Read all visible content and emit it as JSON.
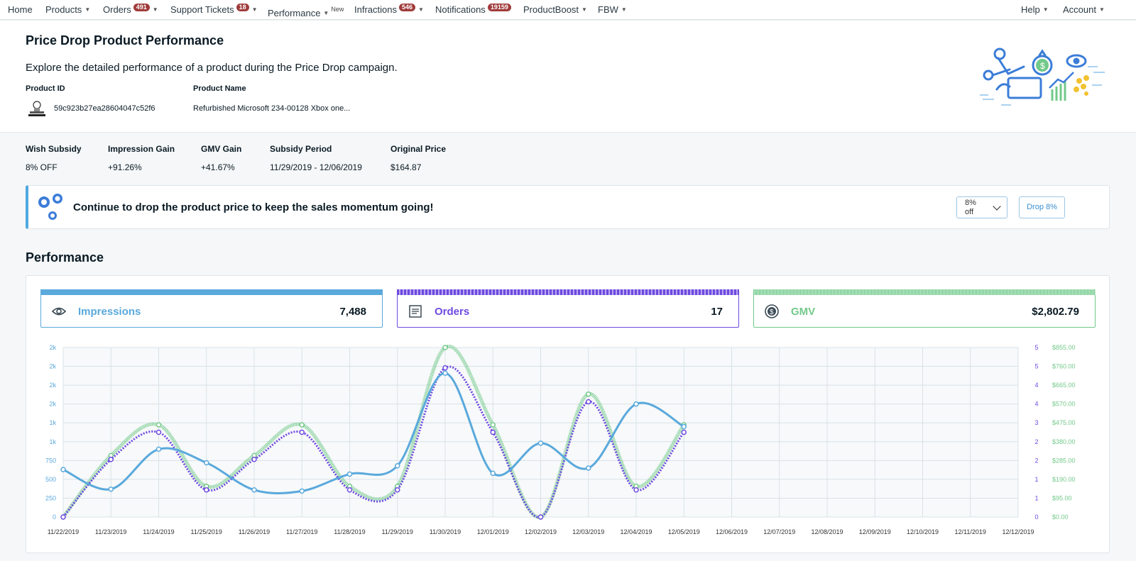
{
  "nav": {
    "home": "Home",
    "products": "Products",
    "orders": "Orders",
    "orders_badge": "491",
    "support": "Support Tickets",
    "support_badge": "18",
    "performance": "Performance",
    "performance_tag": "New",
    "infractions": "Infractions",
    "infractions_badge": "546",
    "notifications": "Notifications",
    "notifications_badge": "19159",
    "productboost": "ProductBoost",
    "fbw": "FBW",
    "help": "Help",
    "account": "Account"
  },
  "header": {
    "title": "Price Drop Product Performance",
    "description": "Explore the detailed performance of a product during the Price Drop campaign.",
    "product_id_label": "Product ID",
    "product_id": "59c923b27ea28604047c52f6",
    "product_name_label": "Product Name",
    "product_name": "Refurbished Microsoft 234-00128 Xbox one..."
  },
  "stats": [
    {
      "label": "Wish Subsidy",
      "value": "8% OFF"
    },
    {
      "label": "Impression Gain",
      "value": "+91.26%"
    },
    {
      "label": "GMV Gain",
      "value": "+41.67%"
    },
    {
      "label": "Subsidy Period",
      "value": "11/29/2019 - 12/06/2019"
    },
    {
      "label": "Original Price",
      "value": "$164.87"
    }
  ],
  "banner": {
    "message": "Continue to drop the product price to keep the sales momentum going!",
    "select_value": "8% off",
    "button_label": "Drop 8%"
  },
  "performance": {
    "title": "Performance",
    "cards": [
      {
        "label": "Impressions",
        "value": "7,488",
        "color": "#5aa9dc",
        "icon": "eye-icon"
      },
      {
        "label": "Orders",
        "value": "17",
        "color": "#6e4ae0",
        "icon": "receipt-icon"
      },
      {
        "label": "GMV",
        "value": "$2,802.79",
        "color": "#72c98a",
        "icon": "dollar-coin-icon"
      }
    ]
  },
  "chart_data": {
    "type": "line",
    "x": [
      "11/22/2019",
      "11/23/2019",
      "11/24/2019",
      "11/25/2019",
      "11/26/2019",
      "11/27/2019",
      "11/28/2019",
      "11/29/2019",
      "11/30/2019",
      "12/01/2019",
      "12/02/2019",
      "12/03/2019",
      "12/04/2019",
      "12/05/2019",
      "12/06/2019",
      "12/07/2019",
      "12/08/2019",
      "12/09/2019",
      "12/10/2019",
      "12/11/2019",
      "12/12/2019"
    ],
    "y_left_ticks": [
      "0",
      "250",
      "500",
      "750",
      "1k",
      "1k",
      "2k",
      "2k",
      "2k",
      "2k"
    ],
    "y_right1_ticks": [
      "0",
      "1",
      "1",
      "2",
      "2",
      "3",
      "4",
      "4",
      "5",
      "5"
    ],
    "y_right2_ticks": [
      "$0.00",
      "$95.00",
      "$190.00",
      "$285.00",
      "$380.00",
      "$475.00",
      "$570.00",
      "$665.00",
      "$760.00",
      "$855.00"
    ],
    "series": [
      {
        "name": "Impressions",
        "axis": "left",
        "color": "#5aa9dc",
        "values": [
          630,
          370,
          900,
          720,
          360,
          345,
          570,
          680,
          1910,
          580,
          980,
          650,
          1500,
          1200
        ]
      },
      {
        "name": "Orders",
        "axis": "right1",
        "color": "#6e4ae0",
        "values": [
          0,
          1.7,
          2.5,
          0.8,
          1.7,
          2.5,
          0.8,
          0.8,
          4.4,
          2.5,
          0,
          3.4,
          0.8,
          2.5
        ]
      },
      {
        "name": "GMV",
        "axis": "right2",
        "color": "#72c98a",
        "values": [
          0,
          310,
          465,
          155,
          310,
          465,
          155,
          155,
          855,
          465,
          0,
          620,
          155,
          465
        ]
      }
    ]
  }
}
